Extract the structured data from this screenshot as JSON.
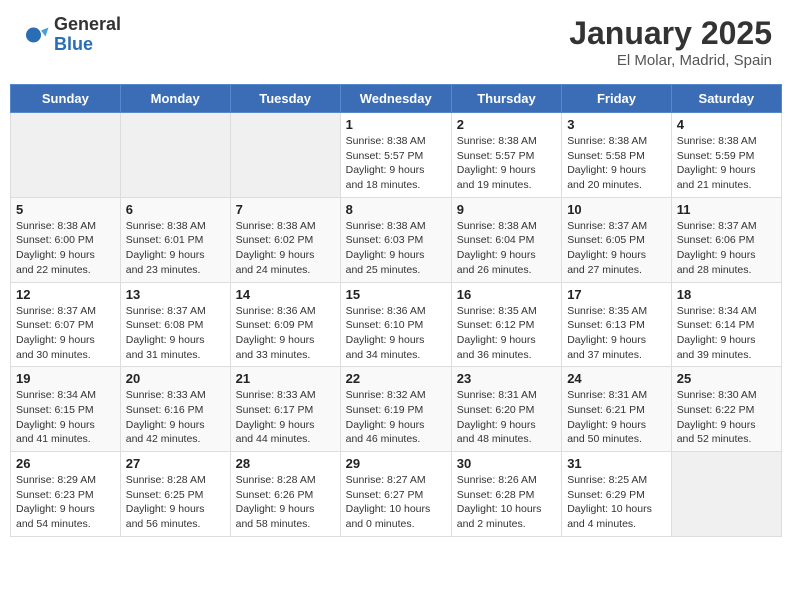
{
  "header": {
    "logo_general": "General",
    "logo_blue": "Blue",
    "month_year": "January 2025",
    "location": "El Molar, Madrid, Spain"
  },
  "weekdays": [
    "Sunday",
    "Monday",
    "Tuesday",
    "Wednesday",
    "Thursday",
    "Friday",
    "Saturday"
  ],
  "weeks": [
    [
      {
        "day": "",
        "info": ""
      },
      {
        "day": "",
        "info": ""
      },
      {
        "day": "",
        "info": ""
      },
      {
        "day": "1",
        "info": "Sunrise: 8:38 AM\nSunset: 5:57 PM\nDaylight: 9 hours\nand 18 minutes."
      },
      {
        "day": "2",
        "info": "Sunrise: 8:38 AM\nSunset: 5:57 PM\nDaylight: 9 hours\nand 19 minutes."
      },
      {
        "day": "3",
        "info": "Sunrise: 8:38 AM\nSunset: 5:58 PM\nDaylight: 9 hours\nand 20 minutes."
      },
      {
        "day": "4",
        "info": "Sunrise: 8:38 AM\nSunset: 5:59 PM\nDaylight: 9 hours\nand 21 minutes."
      }
    ],
    [
      {
        "day": "5",
        "info": "Sunrise: 8:38 AM\nSunset: 6:00 PM\nDaylight: 9 hours\nand 22 minutes."
      },
      {
        "day": "6",
        "info": "Sunrise: 8:38 AM\nSunset: 6:01 PM\nDaylight: 9 hours\nand 23 minutes."
      },
      {
        "day": "7",
        "info": "Sunrise: 8:38 AM\nSunset: 6:02 PM\nDaylight: 9 hours\nand 24 minutes."
      },
      {
        "day": "8",
        "info": "Sunrise: 8:38 AM\nSunset: 6:03 PM\nDaylight: 9 hours\nand 25 minutes."
      },
      {
        "day": "9",
        "info": "Sunrise: 8:38 AM\nSunset: 6:04 PM\nDaylight: 9 hours\nand 26 minutes."
      },
      {
        "day": "10",
        "info": "Sunrise: 8:37 AM\nSunset: 6:05 PM\nDaylight: 9 hours\nand 27 minutes."
      },
      {
        "day": "11",
        "info": "Sunrise: 8:37 AM\nSunset: 6:06 PM\nDaylight: 9 hours\nand 28 minutes."
      }
    ],
    [
      {
        "day": "12",
        "info": "Sunrise: 8:37 AM\nSunset: 6:07 PM\nDaylight: 9 hours\nand 30 minutes."
      },
      {
        "day": "13",
        "info": "Sunrise: 8:37 AM\nSunset: 6:08 PM\nDaylight: 9 hours\nand 31 minutes."
      },
      {
        "day": "14",
        "info": "Sunrise: 8:36 AM\nSunset: 6:09 PM\nDaylight: 9 hours\nand 33 minutes."
      },
      {
        "day": "15",
        "info": "Sunrise: 8:36 AM\nSunset: 6:10 PM\nDaylight: 9 hours\nand 34 minutes."
      },
      {
        "day": "16",
        "info": "Sunrise: 8:35 AM\nSunset: 6:12 PM\nDaylight: 9 hours\nand 36 minutes."
      },
      {
        "day": "17",
        "info": "Sunrise: 8:35 AM\nSunset: 6:13 PM\nDaylight: 9 hours\nand 37 minutes."
      },
      {
        "day": "18",
        "info": "Sunrise: 8:34 AM\nSunset: 6:14 PM\nDaylight: 9 hours\nand 39 minutes."
      }
    ],
    [
      {
        "day": "19",
        "info": "Sunrise: 8:34 AM\nSunset: 6:15 PM\nDaylight: 9 hours\nand 41 minutes."
      },
      {
        "day": "20",
        "info": "Sunrise: 8:33 AM\nSunset: 6:16 PM\nDaylight: 9 hours\nand 42 minutes."
      },
      {
        "day": "21",
        "info": "Sunrise: 8:33 AM\nSunset: 6:17 PM\nDaylight: 9 hours\nand 44 minutes."
      },
      {
        "day": "22",
        "info": "Sunrise: 8:32 AM\nSunset: 6:19 PM\nDaylight: 9 hours\nand 46 minutes."
      },
      {
        "day": "23",
        "info": "Sunrise: 8:31 AM\nSunset: 6:20 PM\nDaylight: 9 hours\nand 48 minutes."
      },
      {
        "day": "24",
        "info": "Sunrise: 8:31 AM\nSunset: 6:21 PM\nDaylight: 9 hours\nand 50 minutes."
      },
      {
        "day": "25",
        "info": "Sunrise: 8:30 AM\nSunset: 6:22 PM\nDaylight: 9 hours\nand 52 minutes."
      }
    ],
    [
      {
        "day": "26",
        "info": "Sunrise: 8:29 AM\nSunset: 6:23 PM\nDaylight: 9 hours\nand 54 minutes."
      },
      {
        "day": "27",
        "info": "Sunrise: 8:28 AM\nSunset: 6:25 PM\nDaylight: 9 hours\nand 56 minutes."
      },
      {
        "day": "28",
        "info": "Sunrise: 8:28 AM\nSunset: 6:26 PM\nDaylight: 9 hours\nand 58 minutes."
      },
      {
        "day": "29",
        "info": "Sunrise: 8:27 AM\nSunset: 6:27 PM\nDaylight: 10 hours\nand 0 minutes."
      },
      {
        "day": "30",
        "info": "Sunrise: 8:26 AM\nSunset: 6:28 PM\nDaylight: 10 hours\nand 2 minutes."
      },
      {
        "day": "31",
        "info": "Sunrise: 8:25 AM\nSunset: 6:29 PM\nDaylight: 10 hours\nand 4 minutes."
      },
      {
        "day": "",
        "info": ""
      }
    ]
  ]
}
